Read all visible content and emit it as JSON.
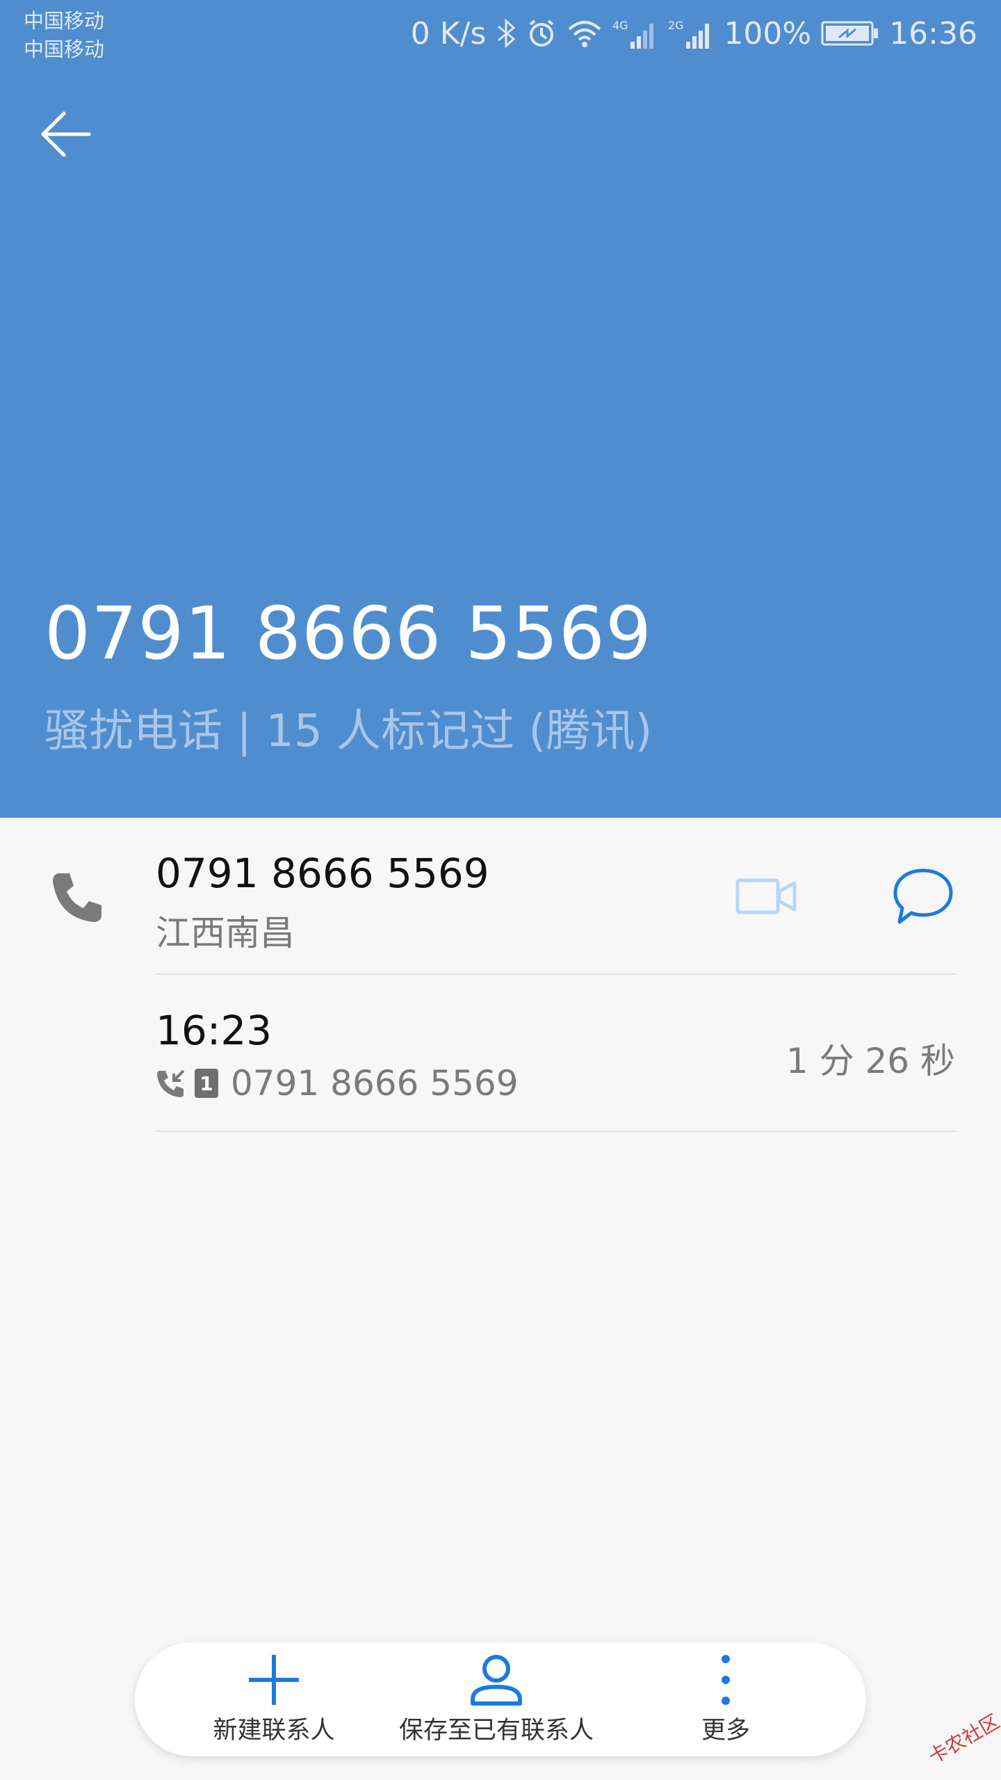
{
  "status_bar": {
    "carrier_1": "中国移动",
    "carrier_2": "中国移动",
    "speed": "0 K/s",
    "battery": "100%",
    "time": "16:36"
  },
  "header": {
    "number": "0791 8666 5569",
    "tagline": "骚扰电话 | 15 人标记过 (腾讯)",
    "background_color": "#508dce"
  },
  "contact": {
    "number": "0791 8666 5569",
    "location": "江西南昌"
  },
  "call_log": {
    "time": "16:23",
    "number": "0791 8666 5569",
    "sim": "1",
    "duration": "1 分 26 秒"
  },
  "bottom_bar": {
    "new_contact": "新建联系人",
    "save_existing": "保存至已有联系人",
    "more": "更多",
    "accent_color": "#1a7be0"
  },
  "watermark": "卡农社区"
}
